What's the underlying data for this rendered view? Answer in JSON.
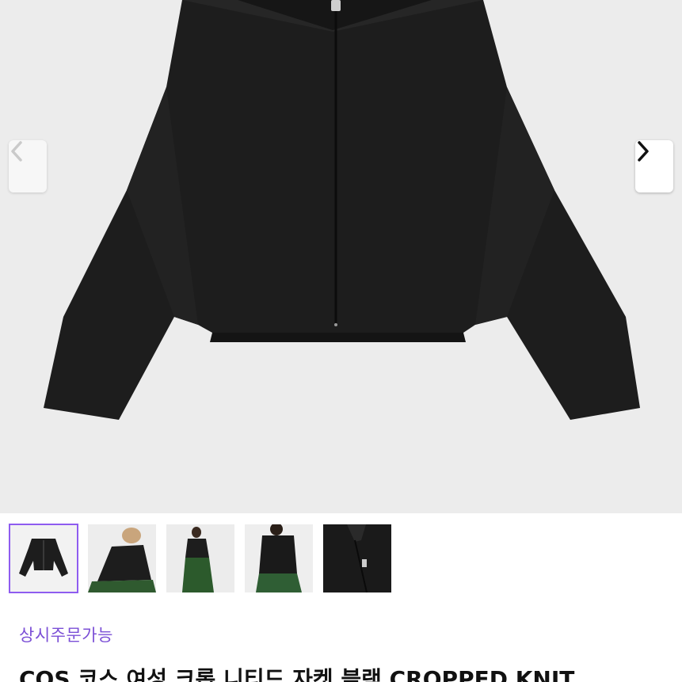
{
  "gallery": {
    "prev_icon": "chevron-left-icon",
    "next_icon": "chevron-right-icon",
    "thumbnails": [
      {
        "name": "thumb-jacket-flat",
        "selected": true
      },
      {
        "name": "thumb-model-front",
        "selected": false
      },
      {
        "name": "thumb-model-full",
        "selected": false
      },
      {
        "name": "thumb-model-side",
        "selected": false
      },
      {
        "name": "thumb-detail-zip",
        "selected": false
      }
    ]
  },
  "product": {
    "status": "상시주문가능",
    "title": "COS 코스 여성 크롭 니티드 자켓 블랙 CROPPED KNIT"
  },
  "colors": {
    "accent": "#8e5cf0",
    "status_text": "#7b4fd6",
    "hero_bg": "#ececec",
    "jacket": "#1d1d1d"
  }
}
